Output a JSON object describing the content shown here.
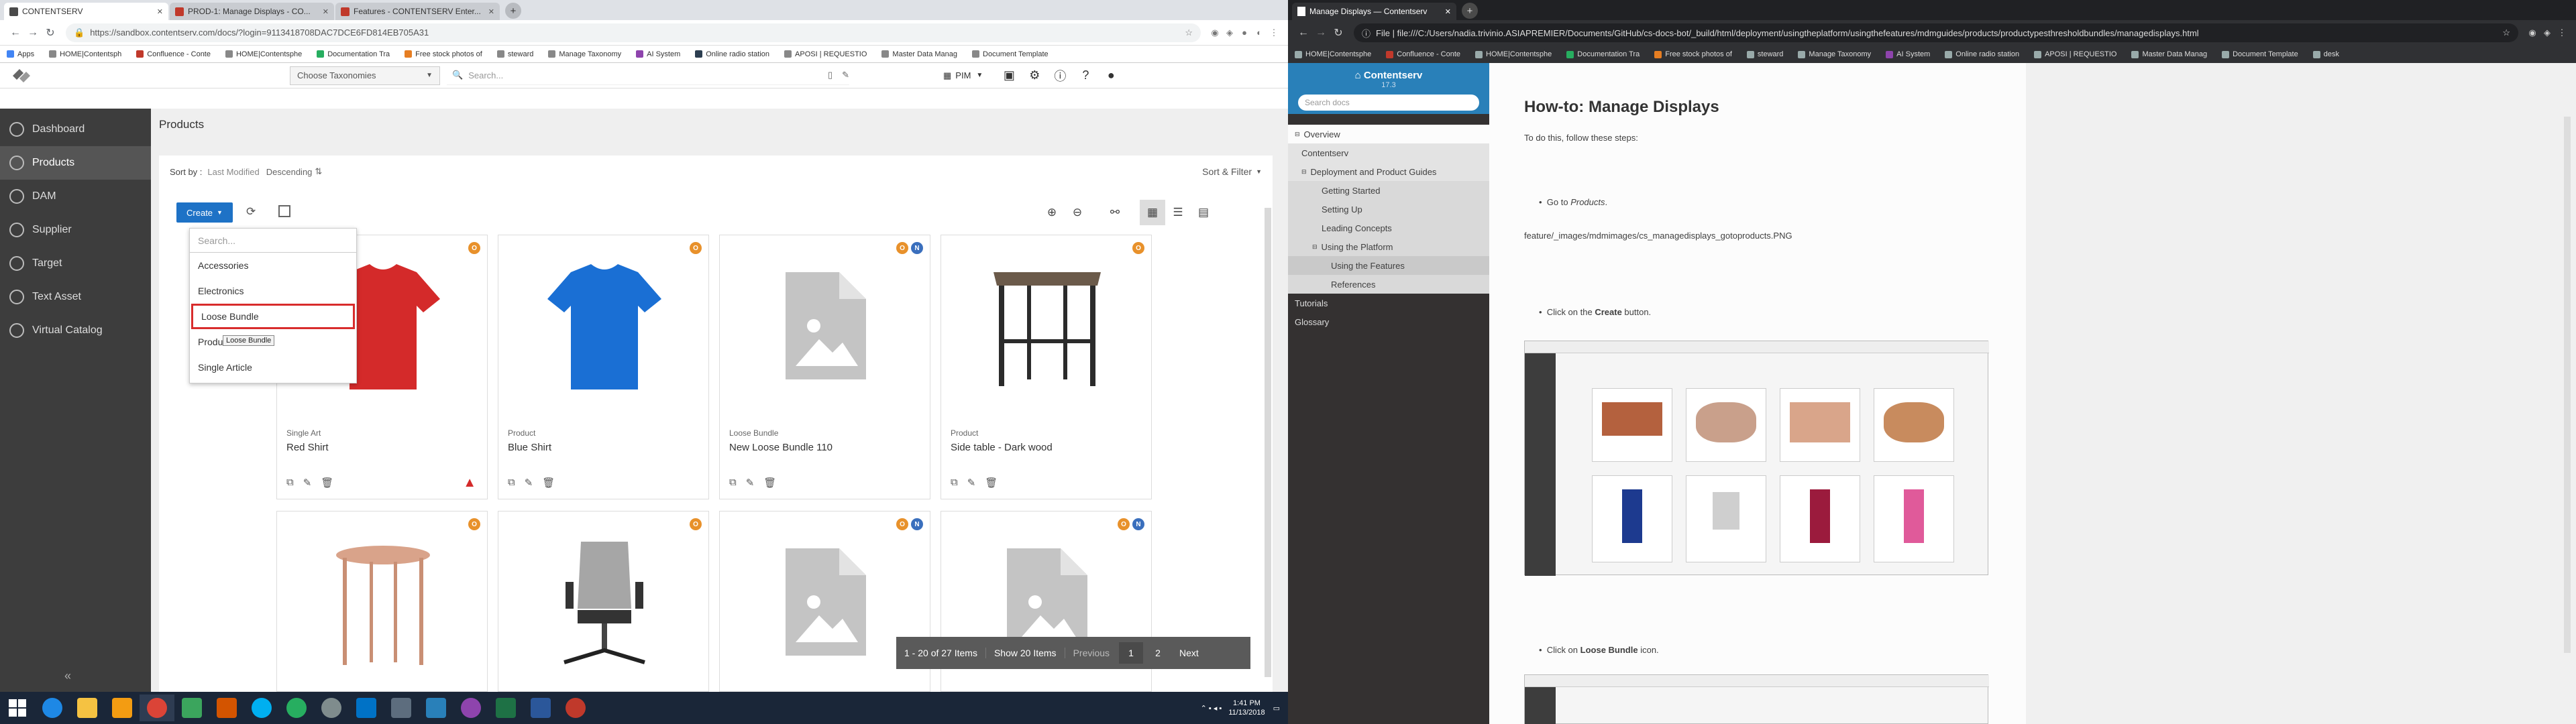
{
  "left_browser": {
    "tabs": [
      {
        "title": "CONTENTSERV",
        "active": true
      },
      {
        "title": "PROD-1: Manage Displays - CO...",
        "active": false
      },
      {
        "title": "Features - CONTENTSERV Enter...",
        "active": false
      }
    ],
    "url": "https://sandbox.contentserv.com/docs/?login=9113418708DAC7DCE6FD814EB705A31",
    "bookmarks": [
      "Apps",
      "HOME|Contentsph",
      "Confluence - Conte",
      "HOME|Contentsphe",
      "Documentation Tra",
      "Free stock photos of",
      "steward",
      "Manage Taxonomy",
      "AI System",
      "Online radio station",
      "APOSI | REQUESTIO",
      "Master Data Manag",
      "Document Template"
    ]
  },
  "app": {
    "taxonomy_label": "Choose Taxonomies",
    "search_placeholder": "Search...",
    "pim_label": "PIM",
    "sidebar": [
      {
        "label": "Dashboard",
        "active": false
      },
      {
        "label": "Products",
        "active": true
      },
      {
        "label": "DAM",
        "active": false
      },
      {
        "label": "Supplier",
        "active": false
      },
      {
        "label": "Target",
        "active": false
      },
      {
        "label": "Text Asset",
        "active": false
      },
      {
        "label": "Virtual Catalog",
        "active": false
      }
    ],
    "page_title": "Products",
    "sort_by_label": "Sort by :",
    "sort_field": "Last Modified",
    "sort_order": "Descending",
    "sort_filter_label": "Sort & Filter",
    "create_label": "Create",
    "dropdown": {
      "search_placeholder": "Search...",
      "items": [
        "Accessories",
        "Electronics",
        "Loose Bundle",
        "Product",
        "Single Article"
      ],
      "tooltip": "Loose Bundle"
    },
    "cards": [
      {
        "kind": "Single Art",
        "name": "Red Shirt"
      },
      {
        "kind": "Product",
        "name": "Blue Shirt"
      },
      {
        "kind": "Loose Bundle",
        "name": "New Loose Bundle 110"
      },
      {
        "kind": "Product",
        "name": "Side table - Dark wood"
      }
    ],
    "badges": {
      "o": "O",
      "n": "N"
    },
    "pager": {
      "range": "1 - 20 of 27 Items",
      "show": "Show 20 Items",
      "prev": "Previous",
      "pages": [
        "1",
        "2"
      ],
      "next": "Next"
    }
  },
  "taskbar": {
    "time": "1:41 PM",
    "date": "11/13/2018"
  },
  "right_browser": {
    "tab_title": "Manage Displays — Contentserv",
    "url": "File  |  file:///C:/Users/nadia.trivinio.ASIAPREMIER/Documents/GitHub/cs-docs-bot/_build/html/deployment/usingtheplatform/usingthefeatures/mdmguides/products/productypesthresholdbundles/managedisplays.html",
    "bookmarks": [
      "HOME|Contentsphe",
      "Confluence - Conte",
      "HOME|Contentsphe",
      "Documentation Tra",
      "Free stock photos of",
      "steward",
      "Manage Taxonomy",
      "AI System",
      "Online radio station",
      "APOSI | REQUESTIO",
      "Master Data Manag",
      "Document Template",
      "desk"
    ],
    "brand": "Contentserv",
    "version": "17.3",
    "search_placeholder": "Search docs",
    "nav": [
      {
        "label": "Overview",
        "level": 1
      },
      {
        "label": "Contentserv",
        "level": 2
      },
      {
        "label": "Deployment and Product Guides",
        "level": 2
      },
      {
        "label": "Getting Started",
        "level": 3
      },
      {
        "label": "Setting Up",
        "level": 3
      },
      {
        "label": "Leading Concepts",
        "level": 3
      },
      {
        "label": "Using the Platform",
        "level": 3
      },
      {
        "label": "Using the Features",
        "level": 4
      },
      {
        "label": "References",
        "level": 4
      },
      {
        "label": "Tutorials",
        "level": 1
      },
      {
        "label": "Glossary",
        "level": 1
      }
    ],
    "doc": {
      "title": "How-to: Manage Displays",
      "intro": "To do this, follow these steps:",
      "step1_prefix": "Go to ",
      "step1_em": "Products",
      "step1_suffix": ".",
      "img_alt": "feature/_images/mdmimages/cs_managedisplays_gotoproducts.PNG",
      "step2_prefix": "Click on the ",
      "step2_b": "Create",
      "step2_suffix": " button.",
      "step3_prefix": "Click on ",
      "step3_b": "Loose Bundle",
      "step3_suffix": " icon."
    }
  }
}
